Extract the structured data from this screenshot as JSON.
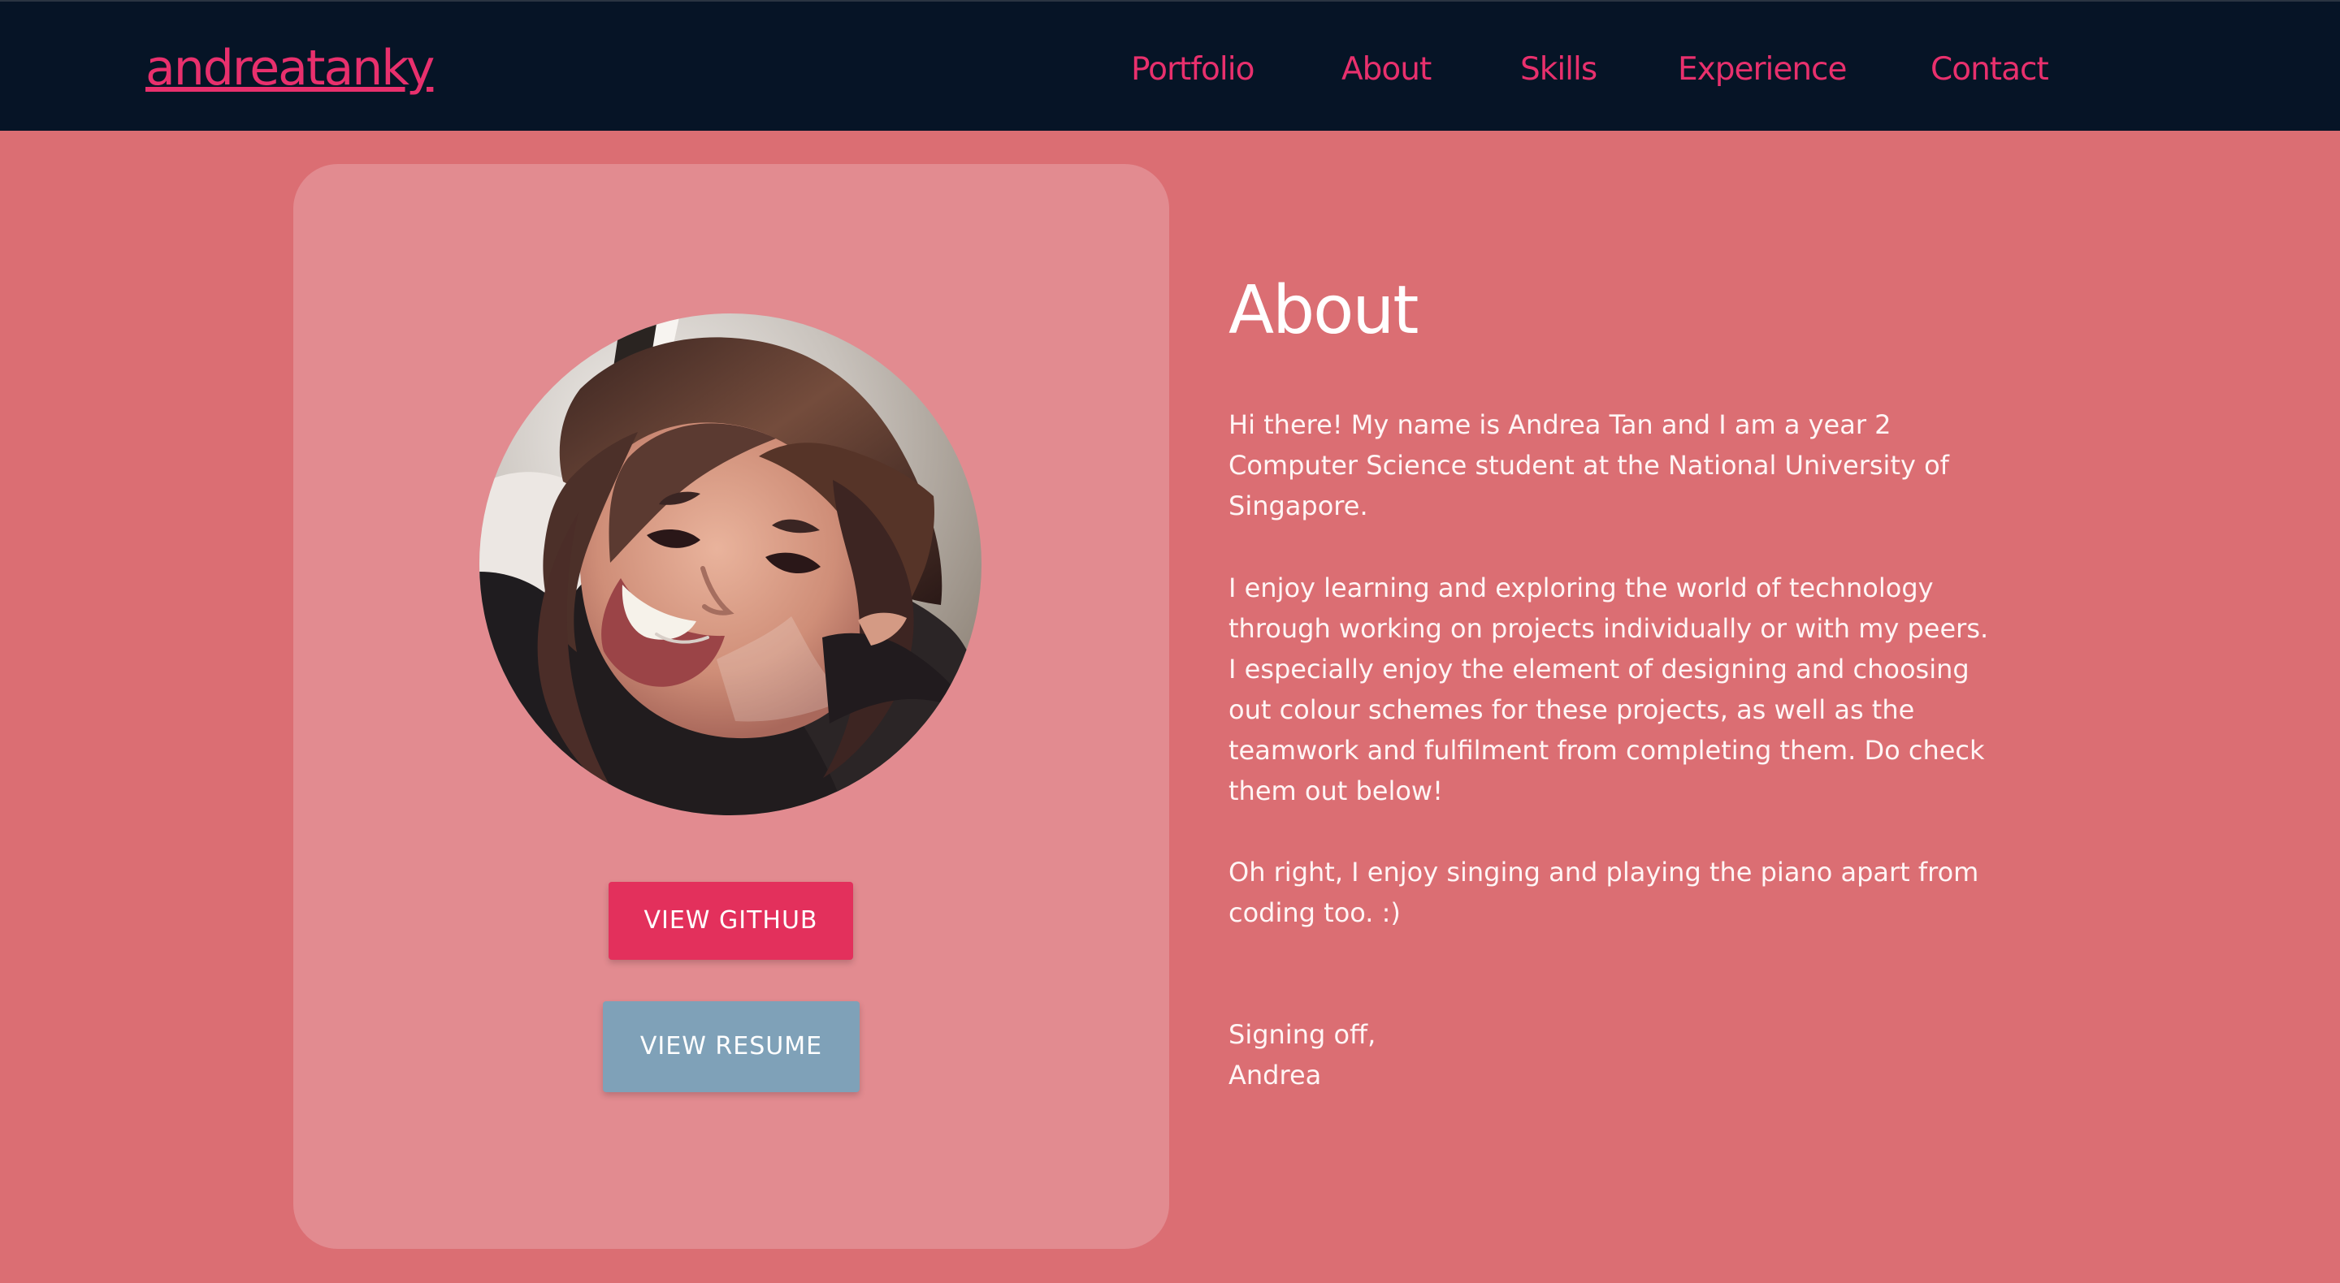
{
  "site": {
    "logo_text": "andreatanky"
  },
  "nav": {
    "items": [
      "Portfolio",
      "About",
      "Skills",
      "Experience",
      "Contact"
    ]
  },
  "profile": {
    "buttons": {
      "github": "VIEW GITHUB",
      "resume": "VIEW RESUME"
    }
  },
  "about": {
    "title": "About",
    "paragraphs": [
      "Hi there! My name is Andrea Tan and I am a year 2 Computer Science student at the National University of Singapore.",
      "I enjoy learning and exploring the world of technology through working on projects individually or with my peers. I especially enjoy the element of designing and choosing out colour schemes for these projects, as well as the teamwork and fulfilment from completing them. Do check them out below!",
      "Oh right, I enjoy singing and playing the piano apart from coding too. :)"
    ],
    "signoff": {
      "line1": "Signing off,",
      "line2": "Andrea"
    }
  },
  "colors": {
    "page_background": "#db6e73",
    "header_background": "#061426",
    "accent": "#e8306d",
    "card_background": "#e28b90",
    "github_button": "#e3305c",
    "resume_button": "#7fa1b8",
    "text": "#ffffff"
  }
}
